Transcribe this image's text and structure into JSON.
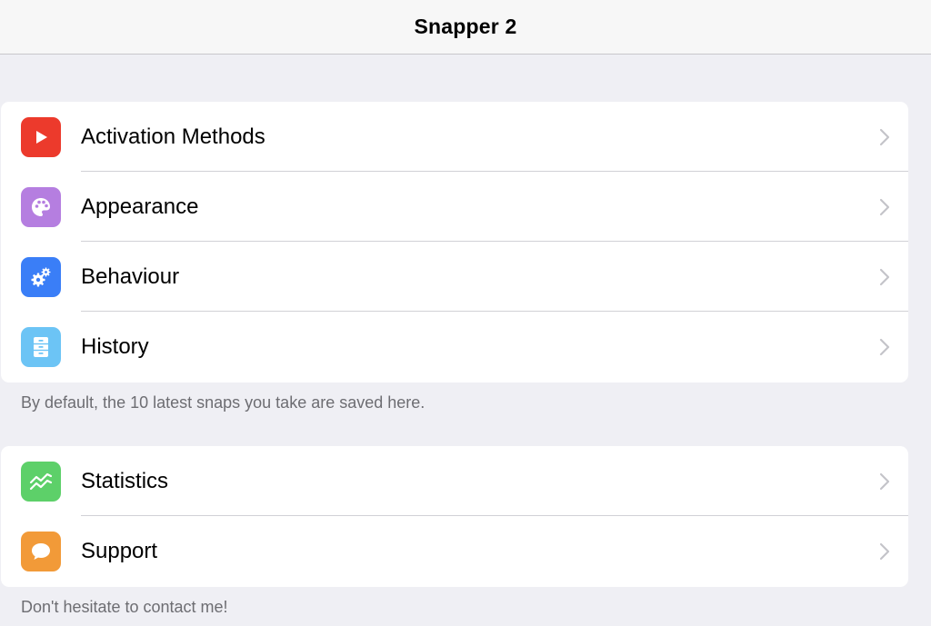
{
  "navbar": {
    "title": "Snapper 2"
  },
  "colors": {
    "activation": "#ec3a2c",
    "appearance": "#b57ee0",
    "behaviour": "#3a7ef7",
    "history": "#6cc4f5",
    "statistics": "#5dd069",
    "support": "#f29a38"
  },
  "groups": [
    {
      "items": [
        {
          "label": "Activation Methods",
          "icon": "play-icon"
        },
        {
          "label": "Appearance",
          "icon": "palette-icon"
        },
        {
          "label": "Behaviour",
          "icon": "gears-icon"
        },
        {
          "label": "History",
          "icon": "drawer-icon"
        }
      ],
      "footer": "By default, the 10 latest snaps you take are saved here."
    },
    {
      "items": [
        {
          "label": "Statistics",
          "icon": "chart-icon"
        },
        {
          "label": "Support",
          "icon": "speech-bubble-icon"
        }
      ],
      "footer": "Don't hesitate to contact me!"
    }
  ]
}
